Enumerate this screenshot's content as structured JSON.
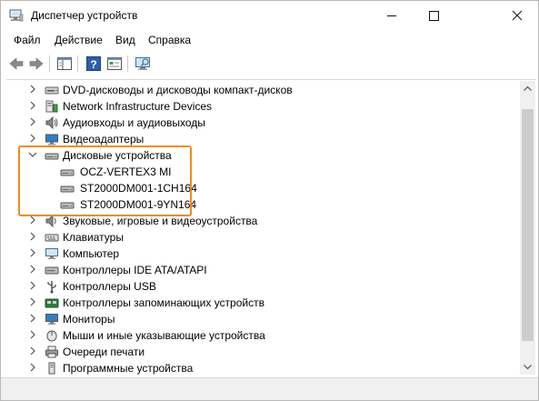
{
  "window": {
    "title": "Диспетчер устройств",
    "minimize_glyph": "—",
    "maximize_glyph": "☐",
    "close_glyph": "✕"
  },
  "menu": [
    {
      "label": "Файл"
    },
    {
      "label": "Действие"
    },
    {
      "label": "Вид"
    },
    {
      "label": "Справка"
    }
  ],
  "toolbar": {
    "buttons": [
      "back-arrow-icon",
      "forward-arrow-icon",
      "show-hide-console-tree-icon",
      "help-icon",
      "properties-icon",
      "scan-hardware-icon"
    ]
  },
  "tree": {
    "items": [
      {
        "label": "DVD-дисководы и дисководы компакт-дисков",
        "expanded": false,
        "icon": "dvd-drive-icon"
      },
      {
        "label": "Network Infrastructure Devices",
        "expanded": false,
        "icon": "network-infrastructure-icon"
      },
      {
        "label": "Аудиовходы и аудиовыходы",
        "expanded": false,
        "icon": "speaker-icon"
      },
      {
        "label": "Видеоадаптеры",
        "expanded": false,
        "icon": "display-adapter-icon"
      },
      {
        "label": "Дисковые устройства",
        "expanded": true,
        "icon": "disk-drive-icon",
        "children": [
          {
            "label": "OCZ-VERTEX3 MI",
            "icon": "disk-drive-icon"
          },
          {
            "label": "ST2000DM001-1CH164",
            "icon": "disk-drive-icon"
          },
          {
            "label": "ST2000DM001-9YN164",
            "icon": "disk-drive-icon"
          }
        ]
      },
      {
        "label": "Звуковые, игровые и видеоустройства",
        "expanded": false,
        "icon": "sound-device-icon"
      },
      {
        "label": "Клавиатуры",
        "expanded": false,
        "icon": "keyboard-icon"
      },
      {
        "label": "Компьютер",
        "expanded": false,
        "icon": "computer-icon"
      },
      {
        "label": "Контроллеры IDE ATA/ATAPI",
        "expanded": false,
        "icon": "ide-controller-icon"
      },
      {
        "label": "Контроллеры USB",
        "expanded": false,
        "icon": "usb-icon"
      },
      {
        "label": "Контроллеры запоминающих устройств",
        "expanded": false,
        "icon": "storage-controller-icon"
      },
      {
        "label": "Мониторы",
        "expanded": false,
        "icon": "monitor-icon"
      },
      {
        "label": "Мыши и иные указывающие устройства",
        "expanded": false,
        "icon": "mouse-icon"
      },
      {
        "label": "Очереди печати",
        "expanded": false,
        "icon": "printer-icon"
      },
      {
        "label": "Программные устройства",
        "expanded": false,
        "icon": "software-device-icon"
      }
    ]
  },
  "colors": {
    "highlight_border": "#f28a1b",
    "chevron": "#505050"
  }
}
